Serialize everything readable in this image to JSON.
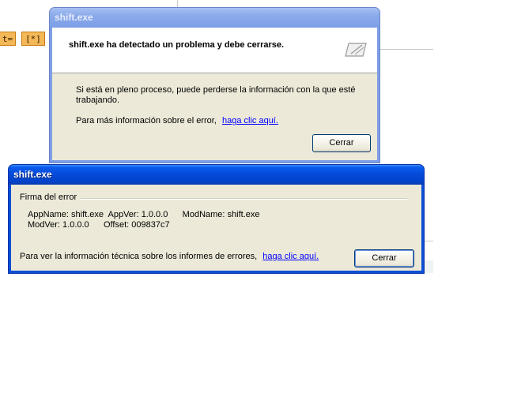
{
  "background": {
    "btn1_label": "t=",
    "btn2_label": "[*]"
  },
  "dialog1": {
    "title": "shift.exe",
    "heading": "shift.exe ha detectado un problema y debe cerrarse.",
    "message": "Si está en pleno proceso, puede perderse la información con la que esté trabajando.",
    "more_info_text": "Para más información sobre el error,",
    "more_info_link": "haga clic aquí.",
    "close_label": "Cerrar"
  },
  "dialog2": {
    "title": "shift.exe",
    "group_label": "Firma del error",
    "sig_line1": "AppName: shift.exe  AppVer: 1.0.0.0      ModName: shift.exe",
    "sig_line2": "ModVer: 1.0.0.0      Offset: 009837c7",
    "tech_info_text": "Para ver la información técnica sobre los informes de errores,",
    "tech_info_link": "haga clic aquí.",
    "close_label": "Cerrar"
  },
  "colors": {
    "title_active": "#0a4fd6",
    "title_inactive": "#7e9ee6",
    "dialog_face": "#ece9d8",
    "link": "#0000ff",
    "bg_button": "#f4b858"
  }
}
